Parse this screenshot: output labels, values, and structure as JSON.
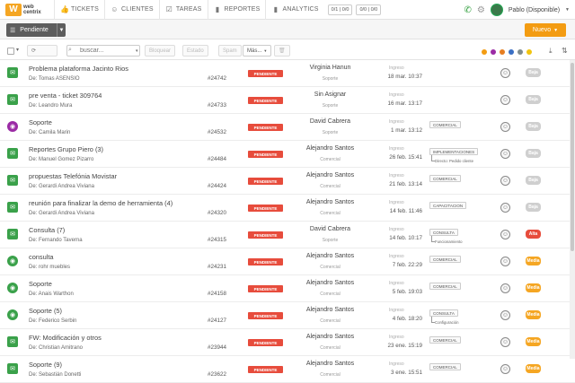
{
  "topbar": {
    "logo_line1": "web",
    "logo_line2": "centrix",
    "nav": [
      {
        "label": "TICKETS",
        "icon": "thumbs-up-icon"
      },
      {
        "label": "CLIENTES",
        "icon": "smiley-icon"
      },
      {
        "label": "TAREAS",
        "icon": "checkbox-icon"
      },
      {
        "label": "REPORTES",
        "icon": "bar-chart-icon"
      },
      {
        "label": "ANALYTICS",
        "icon": "bar-chart-icon"
      }
    ],
    "counter1": "0/1 | 0/0",
    "counter2": "0/0 | 0/0",
    "user": "Pablo (Disponible)"
  },
  "toolbar": {
    "pendiente_label": "Pendiente",
    "nuevo_label": "Nuevo"
  },
  "filterbar": {
    "search_placeholder": "buscar...",
    "buttons": [
      "Bloquear",
      "Estado",
      "Spam",
      "Más..."
    ]
  },
  "colors": {
    "badge_red": "#e74c3c",
    "accent_orange": "#f39c12",
    "baja": "#cfcfcf",
    "media": "#f5a623",
    "alta": "#e74c3c",
    "dots": [
      "#f39c12",
      "#9b2ba5",
      "#e67e22",
      "#3a6fc4",
      "#7f8c8d",
      "#f1c40f"
    ]
  },
  "tickets": [
    {
      "icon": "mail",
      "subject": "Problema plataforma Jacinto Rios",
      "from": "De: Tomas ASENSIO",
      "number": "#24742",
      "status": "PENDIENTE",
      "agent": "Virginia Hanun",
      "dept": "Soporte",
      "ingreso": "Ingreso",
      "date": "18 mar. 10:37",
      "tag": "",
      "subtag": "",
      "priority": "Baja"
    },
    {
      "icon": "mail",
      "subject": "pre venta - ticket 309764",
      "from": "De: Leandro Mura",
      "number": "#24733",
      "status": "PENDIENTE",
      "agent": "Sin Asignar",
      "dept": "Soporte",
      "ingreso": "Ingreso",
      "date": "16 mar. 13:17",
      "tag": "",
      "subtag": "",
      "priority": "Baja"
    },
    {
      "icon": "globe",
      "subject": "Soporte",
      "from": "De: Camila Marin",
      "number": "#24532",
      "status": "PENDIENTE",
      "agent": "David Cabrera",
      "dept": "Soporte",
      "ingreso": "Ingreso",
      "date": "1 mar. 13:12",
      "tag": "COMERCIAL",
      "subtag": "",
      "priority": "Baja"
    },
    {
      "icon": "mail",
      "subject": "Reportes Grupo Piero (3)",
      "from": "De: Manuel Gomez Pizarro",
      "number": "#24484",
      "status": "PENDIENTE",
      "agent": "Alejandro Santos",
      "dept": "Comercial",
      "ingreso": "Ingreso",
      "date": "26 feb. 15:41",
      "tag": "IMPLEMENTACIONES",
      "subtag": "Directo: Pedido cliente",
      "priority": "Baja"
    },
    {
      "icon": "mail",
      "subject": "propuestas Telefónia Movistar",
      "from": "De: Gerardi Andrea Viviana",
      "number": "#24424",
      "status": "PENDIENTE",
      "agent": "Alejandro Santos",
      "dept": "Comercial",
      "ingreso": "Ingreso",
      "date": "21 feb. 13:14",
      "tag": "COMERCIAL",
      "subtag": "",
      "priority": "Baja"
    },
    {
      "icon": "mail",
      "subject": "reunión para finalizar la demo de herramienta (4)",
      "from": "De: Gerardi Andrea Viviana",
      "number": "#24320",
      "status": "PENDIENTE",
      "agent": "Alejandro Santos",
      "dept": "Comercial",
      "ingreso": "Ingreso",
      "date": "14 feb. 11:46",
      "tag": "CAPACITACION",
      "subtag": "",
      "priority": "Baja"
    },
    {
      "icon": "mail",
      "subject": "Consulta (7)",
      "from": "De: Fernando Taverna",
      "number": "#24315",
      "status": "PENDIENTE",
      "agent": "David Cabrera",
      "dept": "Soporte",
      "ingreso": "Ingreso",
      "date": "14 feb. 10:17",
      "tag": "CONSULTA",
      "subtag": "Funcionamiento",
      "priority": "Alta"
    },
    {
      "icon": "globe2",
      "subject": "consulta",
      "from": "De: rohr muebles",
      "number": "#24231",
      "status": "PENDIENTE",
      "agent": "Alejandro Santos",
      "dept": "Comercial",
      "ingreso": "Ingreso",
      "date": "7 feb. 22:29",
      "tag": "COMERCIAL",
      "subtag": "",
      "priority": "Media"
    },
    {
      "icon": "globe2",
      "subject": "Soporte",
      "from": "De: Anais Warthon",
      "number": "#24158",
      "status": "PENDIENTE",
      "agent": "Alejandro Santos",
      "dept": "Comercial",
      "ingreso": "Ingreso",
      "date": "5 feb. 19:03",
      "tag": "COMERCIAL",
      "subtag": "",
      "priority": "Media"
    },
    {
      "icon": "globe2",
      "subject": "Soporte (5)",
      "from": "De: Federico Serbin",
      "number": "#24127",
      "status": "PENDIENTE",
      "agent": "Alejandro Santos",
      "dept": "Comercial",
      "ingreso": "Ingreso",
      "date": "4 feb. 18:20",
      "tag": "CONSULTA",
      "subtag": "Configuración",
      "priority": "Media"
    },
    {
      "icon": "mail",
      "subject": "FW: Modificación y otros",
      "from": "De: Christian Amitrano",
      "number": "#23944",
      "status": "PENDIENTE",
      "agent": "Alejandro Santos",
      "dept": "Comercial",
      "ingreso": "Ingreso",
      "date": "23 ene. 15:19",
      "tag": "COMERCIAL",
      "subtag": "",
      "priority": "Media"
    },
    {
      "icon": "mail",
      "subject": "Soporte (9)",
      "from": "De: Sebastián Donetti",
      "number": "#23622",
      "status": "PENDIENTE",
      "agent": "Alejandro Santos",
      "dept": "Comercial",
      "ingreso": "Ingreso",
      "date": "3 ene. 15:51",
      "tag": "COMERCIAL",
      "subtag": "",
      "priority": "Media"
    }
  ]
}
